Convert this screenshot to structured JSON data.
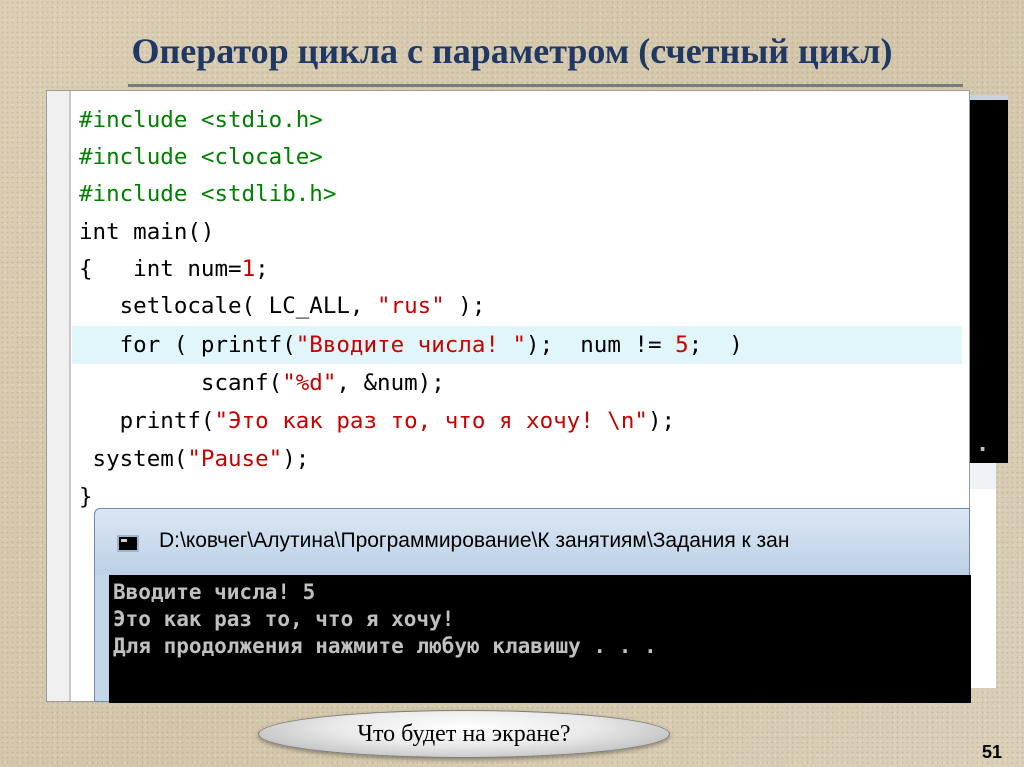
{
  "slide": {
    "title": "Оператор цикла с параметром (счетный цикл)",
    "number": "51"
  },
  "editor": {
    "line1_kw": "#include ",
    "line1_hdr": "<stdio.h>",
    "line2_kw": "#include ",
    "line2_hdr": "<clocale>",
    "line3_kw": "#include ",
    "line3_hdr": "<stdlib.h>",
    "line4": "int main()",
    "line5_a": "{   int num=",
    "line5_num": "1",
    "line5_b": ";",
    "line6_a": "   setlocale( LC_ALL, ",
    "line6_str": "\"rus\"",
    "line6_b": " );",
    "line7_a": "   for ( printf(",
    "line7_str": "\"Вводите числа! \"",
    "line7_b": ");  num != ",
    "line7_num": "5",
    "line7_c": ";  )",
    "line8_a": "         scanf(",
    "line8_str": "\"%d\"",
    "line8_b": ", &num);",
    "line9_a": "   printf(",
    "line9_str": "\"Это как раз то, что я хочу! \\n\"",
    "line9_b": ");",
    "line10_a": " system(",
    "line10_str": "\"Pause\"",
    "line10_b": ");",
    "line11": "}"
  },
  "console": {
    "title": "D:\\ковчег\\Алутина\\Программирование\\К занятиям\\Задания к зан",
    "lines": [
      "Вводите числа! 5",
      "Это как раз то, что я хочу!",
      "Для продолжения нажмите любую клавишу . . ."
    ],
    "bg_dots": "."
  },
  "question": {
    "label": "Что будет на экране?"
  },
  "colors": {
    "title": "#1f3864",
    "preprocessor": "#008000",
    "string": "#c80000",
    "highlight_line": "#e0f6fa",
    "console_text": "#c0c0c0"
  }
}
